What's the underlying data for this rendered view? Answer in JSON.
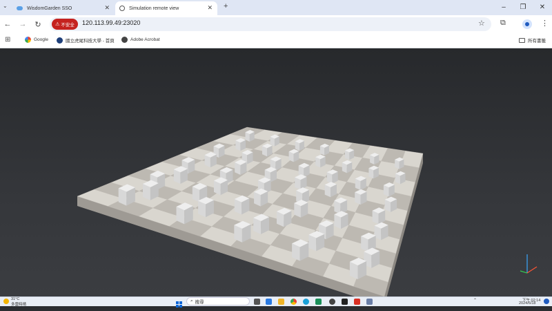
{
  "browser": {
    "tabs": [
      {
        "title": "WisdomGarden SSO",
        "active": false
      },
      {
        "title": "Simulation remote view",
        "active": true
      }
    ],
    "new_tab_glyph": "+",
    "tab_search_glyph": "⌄",
    "close_glyph": "✕",
    "window_controls": {
      "minimize": "–",
      "restore": "❐",
      "close": "✕"
    },
    "nav": {
      "back": "←",
      "forward": "→",
      "reload": "↻"
    },
    "security_label": "不安全",
    "url": "120.113.99.49:23020",
    "star_glyph": "☆",
    "extensions_glyph": "⧉",
    "menu_glyph": "⋮",
    "bookmarks": [
      {
        "label": "Google",
        "icon": "google-icon"
      },
      {
        "label": "國立虎尾科技大學 - 首頁",
        "icon": "nfu-logo-icon"
      },
      {
        "label": "Adobe Acrobat",
        "icon": "acrobat-icon"
      }
    ],
    "all_bookmarks_label": "所有書籤",
    "apps_glyph": "⊞"
  },
  "scene": {
    "description_colors": {
      "board_light": "#d9d6cf",
      "board_dark": "#bdb9b2",
      "cube": "#eeeeee"
    }
  },
  "taskbar": {
    "weather_temp": "31°C",
    "weather_text": "多雲時晴",
    "search_label": "搜尋",
    "time": "下午 02:14",
    "date": "2024/6/18"
  }
}
